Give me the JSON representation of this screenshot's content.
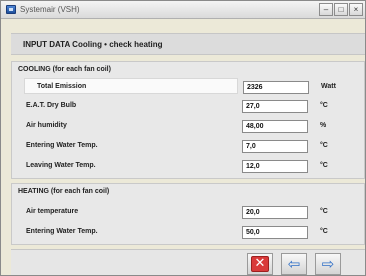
{
  "window": {
    "title": "Systemair (VSH)",
    "minimize_glyph": "–",
    "maximize_glyph": "□",
    "close_glyph": "×"
  },
  "header": {
    "title": "INPUT DATA  Cooling • check heating"
  },
  "cooling": {
    "section_title": "COOLING (for each fan coil)",
    "rows": [
      {
        "label": "Total Emission",
        "value": "2326",
        "unit": "Watt"
      },
      {
        "label": "E.A.T. Dry Bulb",
        "value": "27,0",
        "unit": "°C"
      },
      {
        "label": "Air humidity",
        "value": "48,00",
        "unit": "%"
      },
      {
        "label": "Entering Water Temp.",
        "value": "7,0",
        "unit": "°C"
      },
      {
        "label": "Leaving Water Temp.",
        "value": "12,0",
        "unit": "°C"
      }
    ]
  },
  "heating": {
    "section_title": "HEATING (for each fan coil)",
    "rows": [
      {
        "label": "Air temperature",
        "value": "20,0",
        "unit": "°C"
      },
      {
        "label": "Entering Water Temp.",
        "value": "50,0",
        "unit": "°C"
      }
    ]
  },
  "footer": {
    "close_icon": "x-close-icon",
    "prev_icon": "arrow-left-icon",
    "next_icon": "arrow-right-icon",
    "close_glyph": "✕",
    "prev_glyph": "⇦",
    "next_glyph": "⇨"
  },
  "colors": {
    "close_red": "#d93a3a",
    "arrow_blue": "#2f6fc7",
    "panel_grey": "#e8e8e8"
  }
}
